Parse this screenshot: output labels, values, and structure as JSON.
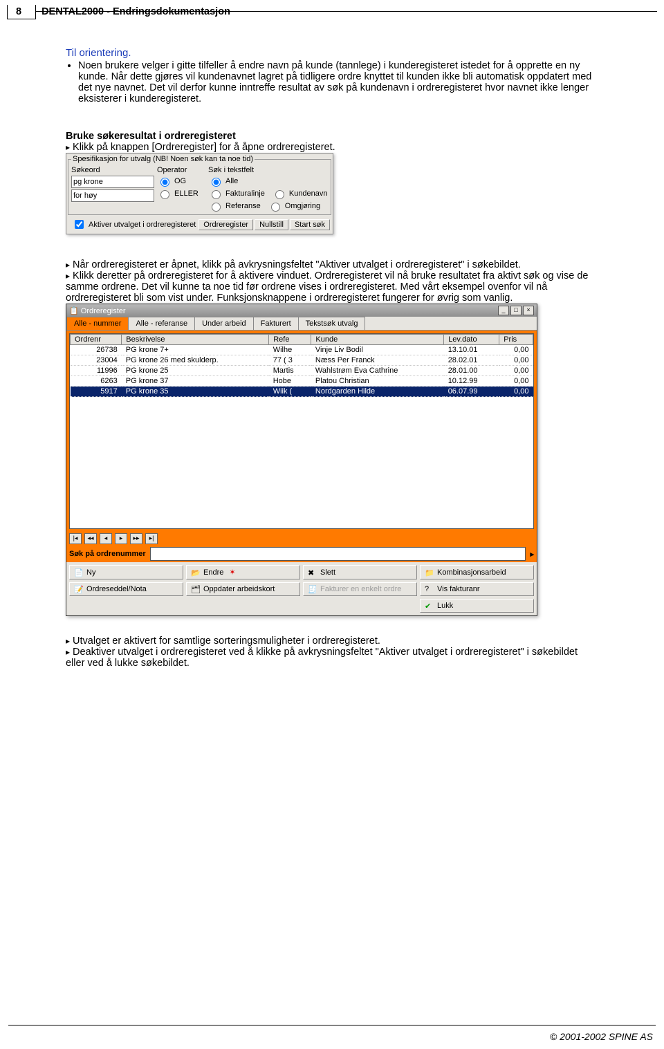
{
  "header": {
    "page_num": "8",
    "title": "DENTAL2000 - Endringsdokumentasjon"
  },
  "orientering": {
    "heading": "Til orientering.",
    "bullet": "Noen brukere velger i gitte tilfeller å endre navn på kunde (tannlege) i kunderegisteret istedet for å opprette en ny kunde. Når dette gjøres vil kundenavnet lagret på tidligere ordre knyttet til kunden ikke bli automatisk oppdatert med det nye navnet. Det vil derfor kunne inntreffe resultat av søk på kundenavn i ordreregisteret hvor navnet ikke lenger eksisterer i kunderegisteret."
  },
  "section2_title": "Bruke søkeresultat i ordreregisteret",
  "step1": "Klikk på knappen [Ordreregister] for å åpne ordreregisteret.",
  "search_panel": {
    "fieldset_label": "Spesifikasjon for utvalg (NB! Noen søk kan ta noe tid)",
    "sokeord_label": "Søkeord",
    "input1": "pg krone",
    "input2": "for høy",
    "operator_label": "Operator",
    "op_og": "OG",
    "op_eller": "ELLER",
    "tekstfelt_label": "Søk i tekstfelt",
    "tf_alle": "Alle",
    "tf_fakturalinje": "Fakturalinje",
    "tf_kundenavn": "Kundenavn",
    "tf_referanse": "Referanse",
    "tf_omgjoring": "Omgjøring",
    "chk_label": "Aktiver utvalget i ordreregisteret",
    "btn_ordreregister": "Ordreregister",
    "btn_nullstill": "Nullstill",
    "btn_startsok": "Start søk"
  },
  "step2": "Når ordreregisteret er åpnet, klikk på avkrysningsfeltet \"Aktiver utvalget i ordreregisteret\" i søkebildet.",
  "step3": "Klikk deretter på ordreregisteret for å aktivere vinduet. Ordreregisteret vil nå bruke resultatet fra aktivt søk og vise de samme ordrene. Det vil kunne ta noe tid før ordrene vises i ordreregisteret. Med vårt eksempel ovenfor vil nå ordreregisteret bli som vist under. Funksjonsknappene i ordreregisteret fungerer for øvrig som vanlig.",
  "win": {
    "title": "Ordreregister",
    "tabs": [
      "Alle - nummer",
      "Alle - referanse",
      "Under arbeid",
      "Fakturert",
      "Tekstsøk utvalg"
    ],
    "active_tab": 0,
    "cols": [
      "Ordrenr",
      "Beskrivelse",
      "Refe",
      "Kunde",
      "Lev.dato",
      "Pris"
    ],
    "rows": [
      {
        "nr": "26738",
        "bes": "PG krone  7+",
        "ref": "Wilhe",
        "kunde": "Vinje Liv Bodil",
        "dato": "13.10.01",
        "pris": "0,00"
      },
      {
        "nr": "23004",
        "bes": "PG krone 26 med skulderp.",
        "ref": "77 ( 3",
        "kunde": "Næss Per Franck",
        "dato": "28.02.01",
        "pris": "0,00"
      },
      {
        "nr": "11996",
        "bes": "PG krone  25",
        "ref": "Martis",
        "kunde": "Wahlstrøm Eva Cathrine",
        "dato": "28.01.00",
        "pris": "0,00"
      },
      {
        "nr": "6263",
        "bes": "PG krone  37",
        "ref": "Hobe",
        "kunde": "Platou Christian",
        "dato": "10.12.99",
        "pris": "0,00"
      },
      {
        "nr": "5917",
        "bes": "PG krone 35",
        "ref": "Wiik (",
        "kunde": "Nordgarden Hilde",
        "dato": "06.07.99",
        "pris": "0,00"
      }
    ],
    "search_label": "Søk på ordrenummer",
    "btns": {
      "ny": "Ny",
      "endre": "Endre",
      "slett": "Slett",
      "kombinasjon": "Kombinasjonsarbeid",
      "ordreseddel": "Ordreseddel/Nota",
      "oppdater": "Oppdater arbeidskort",
      "fakturer": "Fakturer en enkelt ordre",
      "visfakt": "Vis fakturanr",
      "lukk": "Lukk"
    }
  },
  "step4": "Utvalget er aktivert for samtlige sorteringsmuligheter i ordreregisteret.",
  "step5": "Deaktiver utvalget i ordreregisteret ved å klikke på avkrysningsfeltet \"Aktiver utvalget i ordreregisteret\" i søkebildet eller ved å lukke søkebildet.",
  "footer": "© 2001-2002  SPINE AS"
}
